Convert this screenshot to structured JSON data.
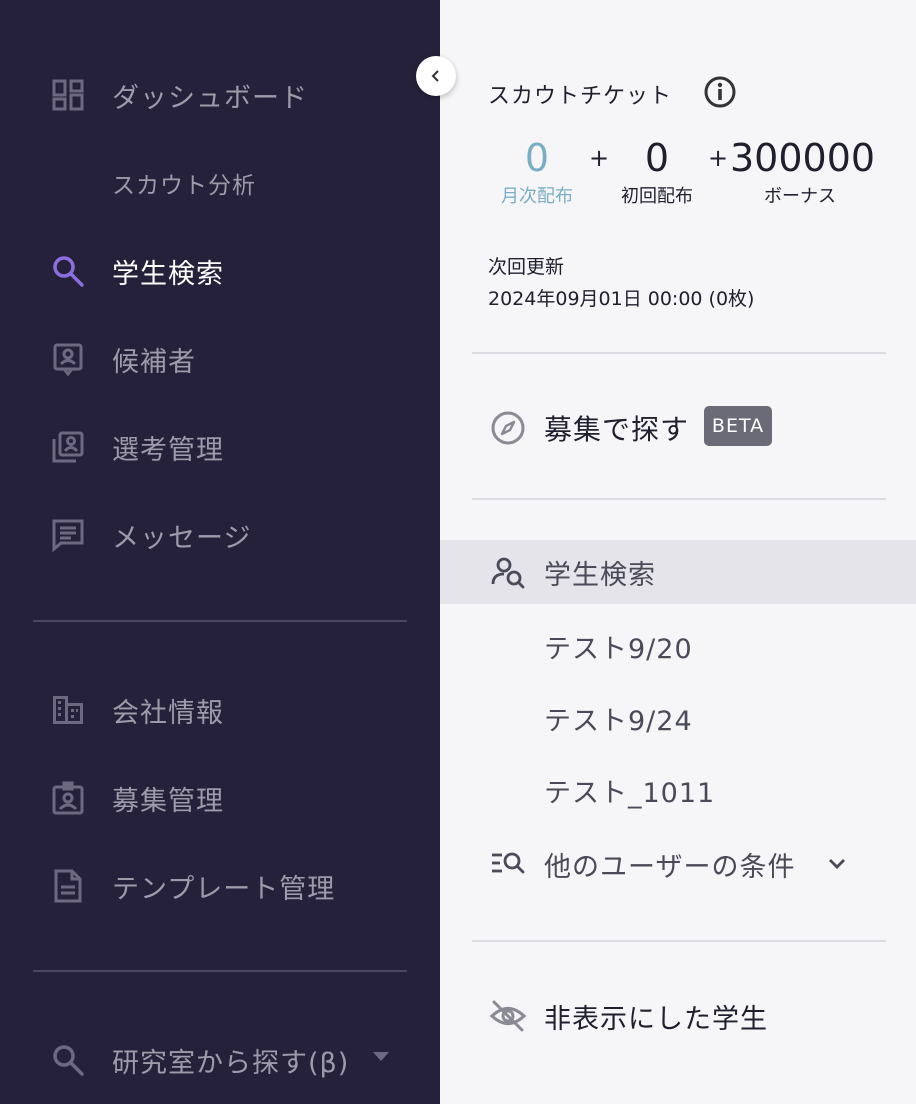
{
  "sidebar": {
    "items": [
      {
        "label": "ダッシュボード",
        "icon": "dashboard-icon"
      },
      {
        "label": "スカウト分析",
        "icon": ""
      },
      {
        "label": "学生検索",
        "icon": "search-icon",
        "active": true
      },
      {
        "label": "候補者",
        "icon": "candidate-icon"
      },
      {
        "label": "選考管理",
        "icon": "selection-icon"
      },
      {
        "label": "メッセージ",
        "icon": "message-icon"
      },
      {
        "label": "会社情報",
        "icon": "company-icon"
      },
      {
        "label": "募集管理",
        "icon": "recruit-icon"
      },
      {
        "label": "テンプレート管理",
        "icon": "template-icon"
      },
      {
        "label": "研究室から探す(β)",
        "icon": "search-icon"
      }
    ],
    "active_color": "#8b6fe0"
  },
  "scout": {
    "title": "スカウトチケット",
    "monthly": {
      "value": "0",
      "caption": "月次配布"
    },
    "initial": {
      "value": "0",
      "caption": "初回配布"
    },
    "bonus": {
      "value": "300000",
      "caption": "ボーナス"
    },
    "plus": "+",
    "next_update_label": "次回更新",
    "next_update_value": "2024年09月01日 00:00 (0枚)"
  },
  "recruit": {
    "label": "募集で探す",
    "badge": "BETA"
  },
  "search": {
    "main": "学生検索",
    "saved": [
      "テスト9/20",
      "テスト9/24",
      "テスト_1011"
    ],
    "others": "他のユーザーの条件"
  },
  "hidden": {
    "label": "非表示にした学生"
  },
  "colors": {
    "sidebar_bg": "#25213a",
    "accent_teal": "#7aaec4",
    "panel_bg": "#f6f6f9"
  }
}
